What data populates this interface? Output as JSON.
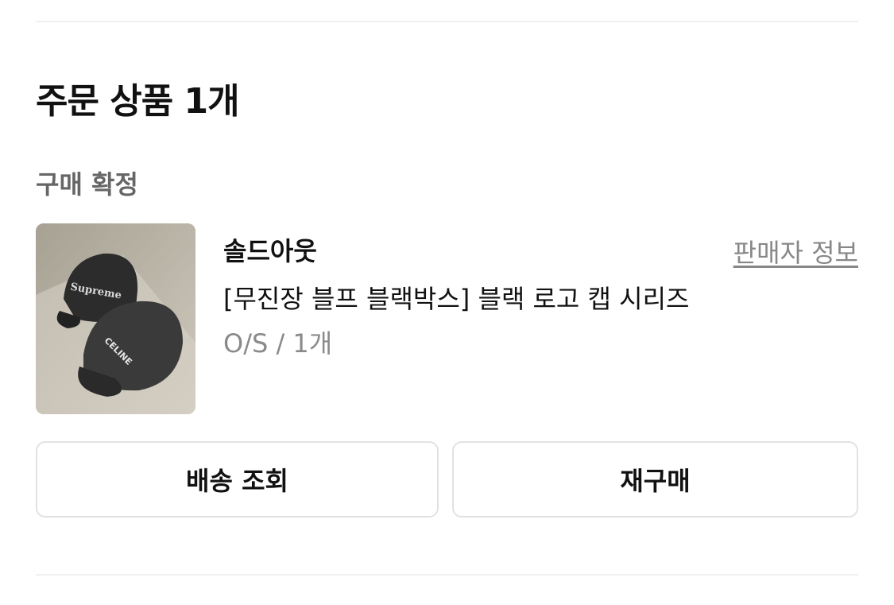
{
  "section": {
    "title": "주문 상품 1개"
  },
  "order": {
    "status": "구매 확정",
    "item": {
      "brand": "솔드아웃",
      "seller_link": "판매자 정보",
      "name": "[무진장 블프 블랙박스] 블랙 로고 캡 시리즈",
      "option": "O/S / 1개",
      "image_cap1_text": "Supreme",
      "image_cap2_text": "CELINE"
    }
  },
  "actions": {
    "track_delivery": "배송 조회",
    "reorder": "재구매"
  }
}
